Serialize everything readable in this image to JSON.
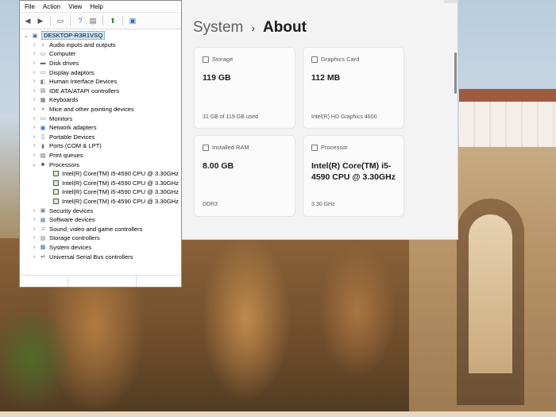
{
  "device_manager": {
    "menu": [
      "File",
      "Action",
      "View",
      "Help"
    ],
    "toolbar_icons": [
      "back-icon",
      "forward-icon",
      "show-hide-icon",
      "help-icon",
      "properties-icon",
      "update-driver-icon",
      "scan-hardware-icon"
    ],
    "root": "DESKTOP-R3R1VSQ",
    "categories": [
      {
        "label": "Audio inputs and outputs",
        "icon": "speaker-icon",
        "expanded": false
      },
      {
        "label": "Computer",
        "icon": "computer-icon",
        "expanded": false
      },
      {
        "label": "Disk drives",
        "icon": "disk-icon",
        "expanded": false
      },
      {
        "label": "Display adaptors",
        "icon": "display-icon",
        "expanded": false
      },
      {
        "label": "Human Interface Devices",
        "icon": "hid-icon",
        "expanded": false
      },
      {
        "label": "IDE ATA/ATAPI controllers",
        "icon": "ide-icon",
        "expanded": false
      },
      {
        "label": "Keyboards",
        "icon": "keyboard-icon",
        "expanded": false
      },
      {
        "label": "Mice and other pointing devices",
        "icon": "mouse-icon",
        "expanded": false
      },
      {
        "label": "Monitors",
        "icon": "monitor-icon",
        "expanded": false
      },
      {
        "label": "Network adapters",
        "icon": "network-icon",
        "expanded": false
      },
      {
        "label": "Portable Devices",
        "icon": "portable-icon",
        "expanded": false
      },
      {
        "label": "Ports (COM & LPT)",
        "icon": "port-icon",
        "expanded": false
      },
      {
        "label": "Print queues",
        "icon": "printer-icon",
        "expanded": false
      },
      {
        "label": "Processors",
        "icon": "processor-icon",
        "expanded": true,
        "children": [
          "Intel(R) Core(TM) i5-4590 CPU @ 3.30GHz",
          "Intel(R) Core(TM) i5-4590 CPU @ 3.30GHz",
          "Intel(R) Core(TM) i5-4590 CPU @ 3.30GHz",
          "Intel(R) Core(TM) i5-4590 CPU @ 3.30GHz"
        ]
      },
      {
        "label": "Security devices",
        "icon": "security-icon",
        "expanded": false
      },
      {
        "label": "Software devices",
        "icon": "software-icon",
        "expanded": false
      },
      {
        "label": "Sound, video and game controllers",
        "icon": "sound-icon",
        "expanded": false
      },
      {
        "label": "Storage controllers",
        "icon": "storage-icon",
        "expanded": false
      },
      {
        "label": "System devices",
        "icon": "system-icon",
        "expanded": false
      },
      {
        "label": "Universal Serial Bus controllers",
        "icon": "usb-icon",
        "expanded": false
      }
    ]
  },
  "settings": {
    "breadcrumb_parent": "System",
    "breadcrumb_current": "About",
    "cards": {
      "storage": {
        "title": "Storage",
        "value": "119 GB",
        "sub": "31 GB of 119 GB used"
      },
      "graphics": {
        "title": "Graphics Card",
        "value": "112 MB",
        "sub": "Intel(R) HD Graphics 4600"
      },
      "ram": {
        "title": "Installed RAM",
        "value": "8.00 GB",
        "sub": "DDR3"
      },
      "processor": {
        "title": "Processor",
        "value": "Intel(R) Core(TM) i5-4590 CPU @ 3.30GHz",
        "sub": "3.30 GHz"
      }
    }
  },
  "colors": {
    "selection": "#cce4f7",
    "settings_bg": "#f3f3f3",
    "card_bg": "#fbfbfb"
  }
}
